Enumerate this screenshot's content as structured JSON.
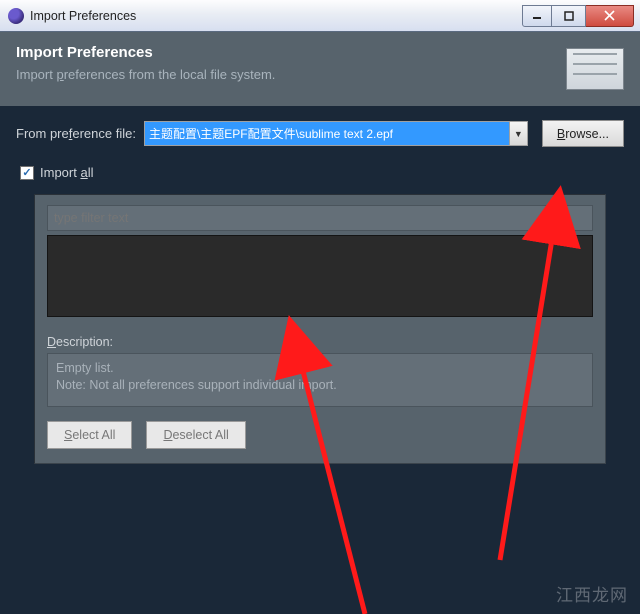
{
  "window": {
    "title": "Import Preferences"
  },
  "header": {
    "title": "Import Preferences",
    "subtitle_pre": "Import ",
    "subtitle_u": "p",
    "subtitle_post": "references from the local file system."
  },
  "form": {
    "from_label_pre": "From pre",
    "from_label_u": "f",
    "from_label_post": "erence file:",
    "file_path": "主题配置\\主题EPF配置文件\\sublime text 2.epf",
    "browse_u": "B",
    "browse_post": "rowse..."
  },
  "import_all": {
    "checked": true,
    "label_pre": "Import ",
    "label_u": "a",
    "label_post": "ll"
  },
  "group": {
    "filter_placeholder": "type filter text",
    "desc_label_u": "D",
    "desc_label_post": "escription:",
    "desc_text": "Empty list.\nNote: Not all preferences support individual import.",
    "select_all_u": "S",
    "select_all_post": "elect All",
    "deselect_all_u": "D",
    "deselect_all_post": "eselect All"
  },
  "watermark": "江西龙网"
}
